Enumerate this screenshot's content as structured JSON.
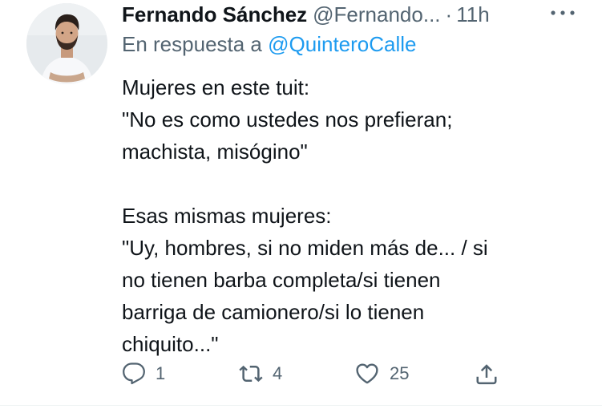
{
  "tweet": {
    "author_name": "Fernando Sánchez",
    "author_handle": "@Fernando...",
    "separator": "·",
    "timestamp": "11h",
    "reply_prefix": "En respuesta a",
    "reply_mention": "@QuinteroCalle",
    "text_lines": [
      "Mujeres en este tuit:",
      "\"No es como ustedes nos prefieran;",
      "machista, misógino\"",
      "",
      "Esas mismas mujeres:",
      "\"Uy, hombres, si no miden más de... / si",
      "no tienen barba completa/si tienen",
      "barriga de camionero/si lo tienen",
      "chiquito...\""
    ]
  },
  "actions": {
    "reply": {
      "icon": "reply-icon",
      "count": "1"
    },
    "retweet": {
      "icon": "retweet-icon",
      "count": "4"
    },
    "like": {
      "icon": "heart-icon",
      "count": "25"
    },
    "share": {
      "icon": "share-icon"
    }
  },
  "icons": {
    "more": "more-horizontal-icon",
    "avatar": "avatar"
  },
  "colors": {
    "text_primary": "#0f1419",
    "text_secondary": "#536471",
    "link": "#1d9bf0",
    "background": "#ffffff"
  }
}
